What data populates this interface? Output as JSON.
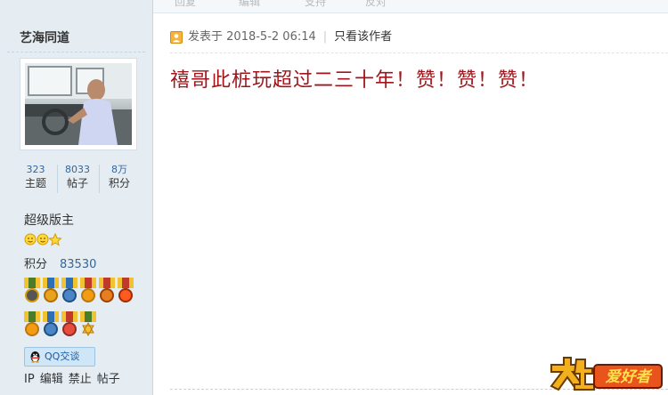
{
  "toolbar": {
    "reply_label": "回复",
    "edit_label": "编辑",
    "support_label": "支持",
    "oppose_label": "反对"
  },
  "user": {
    "name": "艺海同道",
    "stats": [
      {
        "value": "323",
        "label": "主题"
      },
      {
        "value": "8033",
        "label": "帖子"
      },
      {
        "value": "8万",
        "label": "积分"
      }
    ],
    "rank": "超级版主",
    "points_label": "积分",
    "points_value": "83530",
    "qq_label": "QQ交谈",
    "admin_links": [
      "IP",
      "编辑",
      "禁止",
      "帖子"
    ]
  },
  "post": {
    "meta_prefix": "发表于",
    "date": "2018-5-2 06:14",
    "only_author_label": "只看该作者",
    "content": "禧哥此桩玩超过二三十年！赞！赞！赞！"
  },
  "logo": {
    "text": "爱好者"
  },
  "colors": {
    "sidebar_bg": "#e5edf2",
    "content_text": "#a0151b",
    "link": "#336699"
  }
}
